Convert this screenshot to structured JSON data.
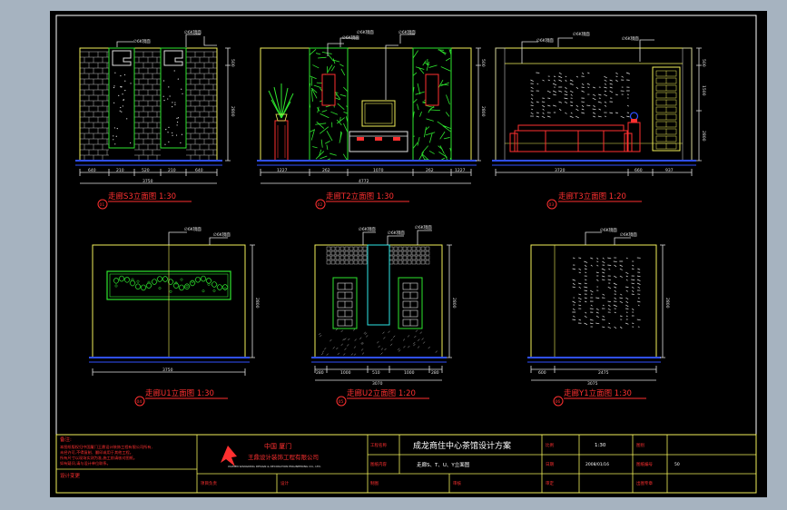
{
  "theme": {
    "app_bg": "#a6b3c0",
    "canvas_bg": "#000000",
    "frame": "#ffffff",
    "elevation": "#f2f05a",
    "brick": "#c0c0c0",
    "plant": "#2ee62e",
    "dim": "#e0e0e0",
    "title_red": "#ff3030",
    "baseline": "#3050ff",
    "sofa": "#ff3030",
    "table_text": "#ffffff"
  },
  "elevations": [
    {
      "id": "s3",
      "number": "01",
      "title": "走廊S3立面图 1:30",
      "dims": [
        "640",
        "210",
        "520",
        "210",
        "640",
        "3750"
      ],
      "heights": [
        "500",
        "2800"
      ]
    },
    {
      "id": "t2",
      "number": "02",
      "title": "走廊T2立面图 1:30",
      "dims": [
        "1227",
        "262",
        "1070",
        "262",
        "1227",
        "4772"
      ],
      "heights": [
        "500",
        "2800"
      ]
    },
    {
      "id": "t3",
      "number": "03",
      "title": "走廊T3立面图 1:20",
      "dims": [
        "3720",
        "660",
        "937"
      ],
      "heights": [
        "500",
        "1500",
        "2800"
      ]
    },
    {
      "id": "u1",
      "number": "04",
      "title": "走廊U1立面图 1:30",
      "dims": [
        "3750"
      ],
      "heights": [
        "2800"
      ]
    },
    {
      "id": "u2",
      "number": "05",
      "title": "走廊U2立面图 1:20",
      "dims": [
        "280",
        "1000",
        "510",
        "1000",
        "280",
        "3070"
      ],
      "heights": [
        "2800"
      ]
    },
    {
      "id": "y1",
      "number": "06",
      "title": "走廊Y1立面图 1:30",
      "dims": [
        "600",
        "2475",
        "3075"
      ],
      "heights": [
        "2800"
      ]
    }
  ],
  "titleblock": {
    "notes_label": "备注:",
    "notes_lines": [
      "本图纸版权归中国厦门王鼎设计装饰工程有限公司所有,",
      "未经许可,不得复制、翻印或用于其他工程。",
      "所有尺寸以现场实测为准,施工前请核对图纸。",
      "如有疑问,请与设计单位联系。"
    ],
    "change_label": "设计变更",
    "company_cn": "中国    厦门",
    "company_cn2": "王鼎设计装饰工程有限公司",
    "company_en": "XIAMEN WANGDING DESIGN & DECORATION ENGINEERING CO., LTD.",
    "project_label": "工程名称",
    "project_name": "成龙商住中心茶馆设计方案",
    "drawing_label": "图纸内容",
    "drawing_name": "走廊S、T、U、Y立面图",
    "scale_label": "比例",
    "scale_value": "1:30",
    "date_label": "日期",
    "date_value": "2008/01/16",
    "type_label": "图别",
    "number_label": "图纸编号",
    "number_value": "50",
    "designer_label": "项目负责",
    "checker_label": "设计",
    "drafter_label": "制图",
    "review_label": "审核",
    "approve_label": "审定",
    "seal_label": "出图专章"
  }
}
